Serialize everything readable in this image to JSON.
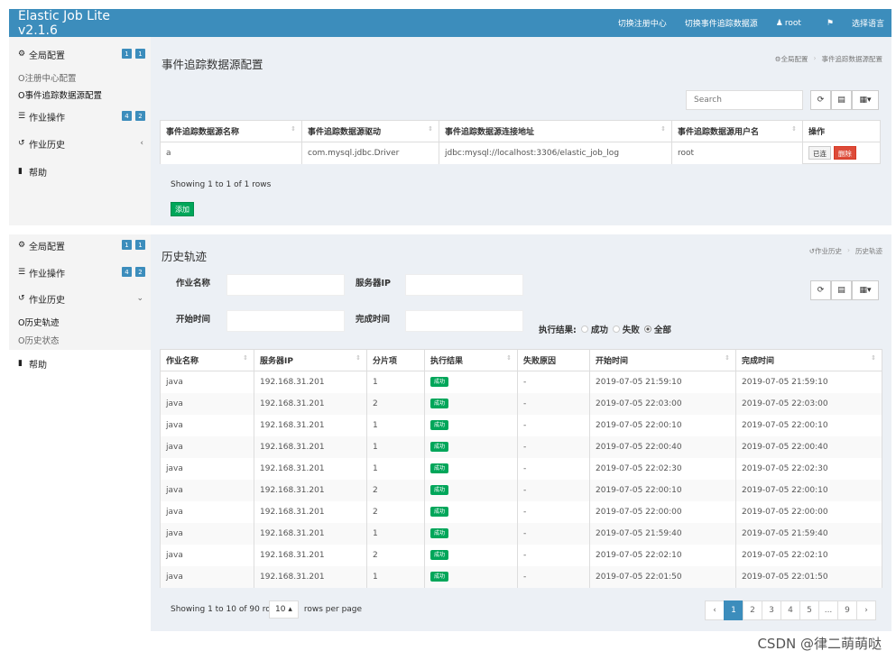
{
  "navbar": {
    "brand": "Elastic Job Lite v2.1.6",
    "items": [
      "切换注册中心",
      "切换事件追踪数据源",
      "root",
      "选择语言"
    ],
    "user_icon": "user-icon",
    "flag_icon": "flag-icon"
  },
  "sidebar1": {
    "global": "全局配置",
    "global_badges": [
      "1",
      "1"
    ],
    "sub_registry": "O注册中心配置",
    "sub_datasource": "O事件追踪数据源配置",
    "ops": "作业操作",
    "ops_badges": [
      "4",
      "2"
    ],
    "history": "作业历史",
    "history_chev": "‹",
    "help": "帮助"
  },
  "panel1": {
    "title": "事件追踪数据源配置",
    "breadcrumb": [
      "全局配置",
      "事件追踪数据源配置"
    ],
    "search_placeholder": "Search",
    "columns": [
      "事件追踪数据源名称",
      "事件追踪数据源驱动",
      "事件追踪数据源连接地址",
      "事件追踪数据源用户名",
      "操作"
    ],
    "row": [
      "a",
      "com.mysql.jdbc.Driver",
      "jdbc:mysql://localhost:3306/elastic_job_log",
      "root"
    ],
    "btn_connected": "已连",
    "btn_delete": "删除",
    "showing": "Showing 1 to 1 of 1 rows",
    "add": "添加"
  },
  "sidebar2": {
    "global": "全局配置",
    "global_badges": [
      "1",
      "1"
    ],
    "ops": "作业操作",
    "ops_badges": [
      "4",
      "2"
    ],
    "history": "作业历史",
    "history_chev": "⌄",
    "sub_trace": "O历史轨迹",
    "sub_status": "O历史状态",
    "help": "帮助"
  },
  "panel2": {
    "title": "历史轨迹",
    "breadcrumb": [
      "作业历史",
      "历史轨迹"
    ],
    "labels": {
      "job_name": "作业名称",
      "server_ip": "服务器IP",
      "start_time": "开始时间",
      "end_time": "完成时间",
      "result": "执行结果:",
      "success": "成功",
      "failure": "失败",
      "all": "全部"
    },
    "columns": [
      "作业名称",
      "服务器IP",
      "分片项",
      "执行结果",
      "失败原因",
      "开始时间",
      "完成时间"
    ],
    "status_label": "成功",
    "rows": [
      [
        "java",
        "192.168.31.201",
        "1",
        "-",
        "2019-07-05 21:59:10",
        "2019-07-05 21:59:10"
      ],
      [
        "java",
        "192.168.31.201",
        "2",
        "-",
        "2019-07-05 22:03:00",
        "2019-07-05 22:03:00"
      ],
      [
        "java",
        "192.168.31.201",
        "1",
        "-",
        "2019-07-05 22:00:10",
        "2019-07-05 22:00:10"
      ],
      [
        "java",
        "192.168.31.201",
        "1",
        "-",
        "2019-07-05 22:00:40",
        "2019-07-05 22:00:40"
      ],
      [
        "java",
        "192.168.31.201",
        "1",
        "-",
        "2019-07-05 22:02:30",
        "2019-07-05 22:02:30"
      ],
      [
        "java",
        "192.168.31.201",
        "2",
        "-",
        "2019-07-05 22:00:10",
        "2019-07-05 22:00:10"
      ],
      [
        "java",
        "192.168.31.201",
        "2",
        "-",
        "2019-07-05 22:00:00",
        "2019-07-05 22:00:00"
      ],
      [
        "java",
        "192.168.31.201",
        "1",
        "-",
        "2019-07-05 21:59:40",
        "2019-07-05 21:59:40"
      ],
      [
        "java",
        "192.168.31.201",
        "2",
        "-",
        "2019-07-05 22:02:10",
        "2019-07-05 22:02:10"
      ],
      [
        "java",
        "192.168.31.201",
        "1",
        "-",
        "2019-07-05 22:01:50",
        "2019-07-05 22:01:50"
      ]
    ],
    "showing": "Showing 1 to 10 of 90 rows",
    "per_page_value": "10 ▴",
    "per_page_text": "rows per page",
    "pages": [
      "‹",
      "1",
      "2",
      "3",
      "4",
      "5",
      "...",
      "9",
      "›"
    ],
    "active_page": "1"
  },
  "watermark": "CSDN @律二萌萌哒",
  "colors": {
    "navbar": "#3c8dbc",
    "success": "#00a65a",
    "danger": "#dd4b39"
  }
}
